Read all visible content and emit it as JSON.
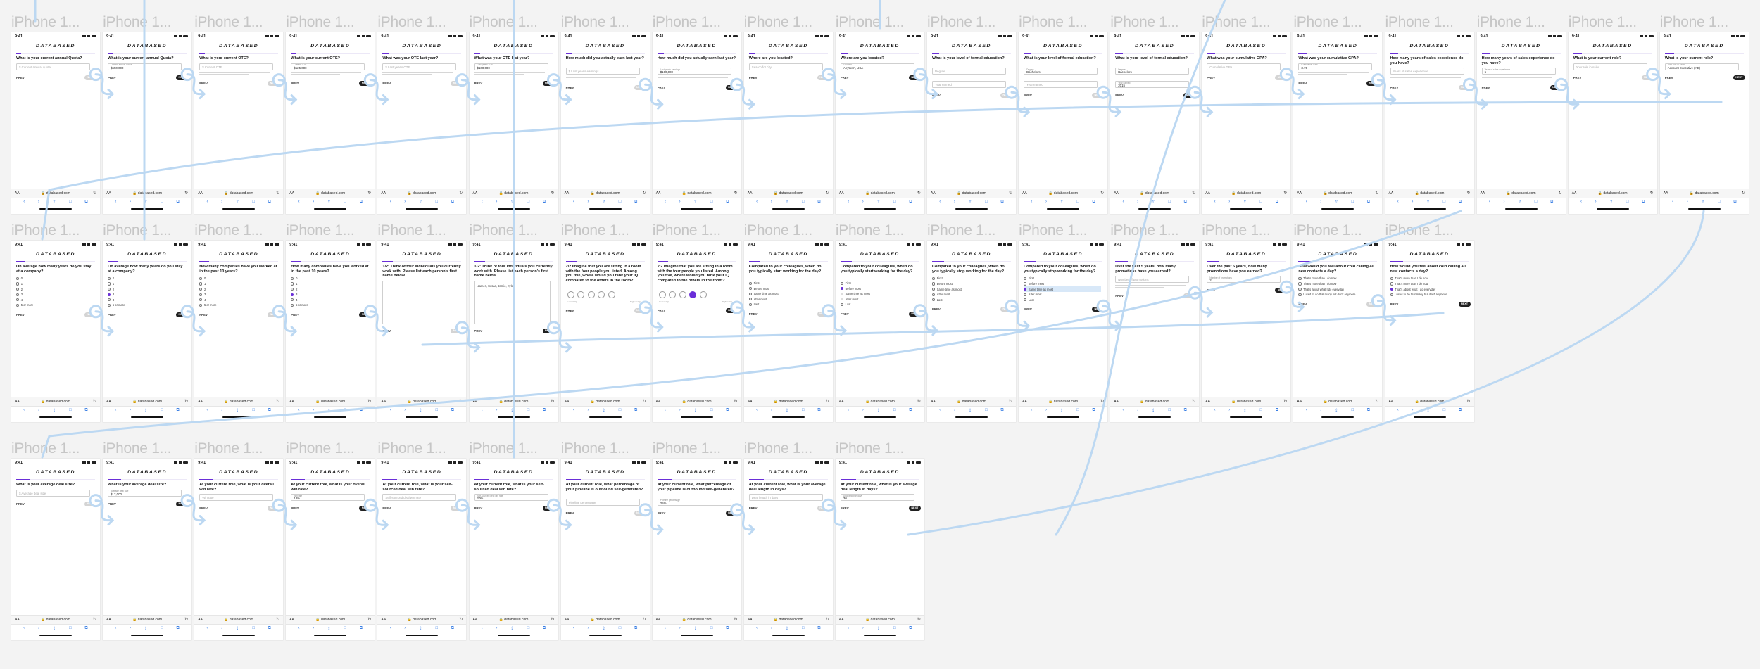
{
  "canvas": {
    "background": "#f3f3f3",
    "accent": "#6a2ed8",
    "flow_color": "#bcd8f2"
  },
  "frame_title": "iPhone 1...",
  "brand": "DATABASED",
  "status_time": "9:41",
  "url": "databased.com",
  "aa": "AA",
  "prev": "PREV",
  "next": "NEXT",
  "rows": [
    {
      "screens": [
        {
          "question": "What is your current annual Quota?",
          "field": {
            "placeholder": "$ Current annual quota"
          },
          "next_active": false
        },
        {
          "question": "What is your current annual Quota?",
          "field": {
            "label": "Current annual quota",
            "value": "$650,000"
          },
          "next_active": true
        },
        {
          "question": "What is your current OTE?",
          "field": {
            "placeholder": "$ Current OTE"
          },
          "hint": true,
          "next_active": false
        },
        {
          "question": "What is your current OTE?",
          "field": {
            "label": "Current OTE",
            "value": "$125,000"
          },
          "hint": true,
          "next_active": true
        },
        {
          "question": "What was your OTE last year?",
          "field": {
            "placeholder": "$ Last year's OTE"
          },
          "hint": true,
          "next_active": false
        },
        {
          "question": "What was your OTE last year?",
          "field": {
            "label": "Last year's OTE",
            "value": "$100,000"
          },
          "hint": true,
          "next_active": true
        },
        {
          "question": "How much did you actually earn last year?",
          "field": {
            "placeholder": "$ Last year's earnings"
          },
          "hint": true,
          "next_active": false
        },
        {
          "question": "How much did you actually earn last year?",
          "field": {
            "label": "Last year's earnings",
            "value": "$100,000"
          },
          "hint": true,
          "next_active": true
        },
        {
          "question": "Where are you located?",
          "field": {
            "placeholder": "Search for city"
          },
          "next_active": false
        },
        {
          "question": "Where are you located?",
          "field": {
            "label": "Location",
            "value": "Anytown, USA"
          },
          "next_active": true
        },
        {
          "question": "What is your level of formal education?",
          "field": {
            "placeholder": "Degree"
          },
          "field2": {
            "placeholder": "Year earned"
          },
          "next_active": false
        },
        {
          "question": "What is your level of formal education?",
          "field": {
            "label": "Degree",
            "value": "Bachelors"
          },
          "field2": {
            "placeholder": "Year earned"
          },
          "next_active": false
        },
        {
          "question": "What is your level of formal education?",
          "field": {
            "label": "Degree",
            "value": "Bachelors"
          },
          "field2": {
            "label": "Year earned",
            "value": "2015"
          },
          "next_active": true
        },
        {
          "question": "What was your cumulative GPA?",
          "field": {
            "placeholder": "Cumulative GPA"
          },
          "next_active": false
        },
        {
          "question": "What was your cumulative GPA?",
          "field": {
            "label": "Cumulative GPA",
            "value": "3.75"
          },
          "hint": true,
          "next_active": true
        },
        {
          "question": "How many years of sales experience do you have?",
          "field": {
            "placeholder": "Years of sales experience"
          },
          "hint": true,
          "next_active": false
        },
        {
          "question": "How many years of sales experience do you have?",
          "field": {
            "label": "Years of sales experience",
            "value": "5"
          },
          "hint": true,
          "next_active": true
        },
        {
          "question": "What is your current role?",
          "field": {
            "placeholder": "Your role in sales"
          },
          "next_active": false
        },
        {
          "question": "What is your current role?",
          "field": {
            "label": "Your role in sales",
            "value": "Account Executive (AE)"
          },
          "next_active": true
        }
      ]
    },
    {
      "screens": [
        {
          "question": "On average how many years do you stay at a company?",
          "options": [
            "0",
            "1",
            "2",
            "3",
            "4",
            "5 or more"
          ],
          "selected": -1,
          "next_active": false
        },
        {
          "question": "On average how many years do you stay at a company?",
          "options": [
            "0",
            "1",
            "2",
            "3",
            "4",
            "5 or more"
          ],
          "selected": 3,
          "next_active": true
        },
        {
          "question": "How many companies have you worked at in the past 10 years?",
          "options": [
            "0",
            "1",
            "2",
            "3",
            "4",
            "5 or more"
          ],
          "selected": -1,
          "next_active": false
        },
        {
          "question": "How many companies have you worked at in the past 10 years?",
          "options": [
            "0",
            "1",
            "2",
            "3",
            "4",
            "5 or more"
          ],
          "selected": 3,
          "next_active": true
        },
        {
          "question": "1/2: Think of four individuals you currently work with. Please list each person's first name below.",
          "textarea": "",
          "next_active": false
        },
        {
          "question": "1/2: Think of four individuals you currently work with. Please list each person's first name below.",
          "textarea": "James, Susan, Jamie, Kyle",
          "next_active": true
        },
        {
          "question": "2/2 Imagine that you are sitting in a room with the four people you listed. Among you five, where would you rank your IQ compared to the others in the room?",
          "circles": 5,
          "circle_selected": -1,
          "scale": [
            "Lowest IQ",
            "Highest IQ"
          ],
          "next_active": false
        },
        {
          "question": "2/2 Imagine that you are sitting in a room with the four people you listed. Among you five, where would you rank your IQ compared to the others in the room?",
          "circles": 5,
          "circle_selected": 3,
          "scale": [
            "Lowest IQ",
            "Highest IQ"
          ],
          "next_active": true
        },
        {
          "question": "Compared to your colleagues, when do you typically start working for the day?",
          "options": [
            "First",
            "Before most",
            "Same time as most",
            "After most",
            "Last"
          ],
          "selected": -1,
          "next_active": false
        },
        {
          "question": "Compared to your colleagues, when do you typically start working for the day?",
          "options": [
            "First",
            "Before most",
            "Same time as most",
            "After most",
            "Last"
          ],
          "selected": 1,
          "next_active": true
        },
        {
          "question": "Compared to your colleagues, when do you typically stop working for the day?",
          "options": [
            "First",
            "Before most",
            "Same time as most",
            "After most",
            "Last"
          ],
          "selected": -1,
          "next_active": false
        },
        {
          "question": "Compared to your colleagues, when do you typically stop working for the day?",
          "options": [
            "First",
            "Before most",
            "Same time as most",
            "After most",
            "Last"
          ],
          "selected": 2,
          "highlight": 2,
          "next_active": true
        },
        {
          "question": "Over the past 5 years, how many promotions have you earned?",
          "field": {
            "placeholder": "Number of promotions"
          },
          "hint": true,
          "next_active": false
        },
        {
          "question": "Over the past 5 years, how many promotions have you earned?",
          "field": {
            "label": "Number of promotions",
            "value": "2"
          },
          "next_active": true
        },
        {
          "question": "How would you feel about cold calling 40 new contacts a day?",
          "options": [
            "That's more than I do now",
            "That's more than I do now",
            "That's about what I do everyday",
            "I used to do that many but don't anymore"
          ],
          "selected": -1,
          "next_active": false
        },
        {
          "question": "How would you feel about cold calling 40 new contacts a day?",
          "options": [
            "That's more than I do now",
            "That's more than I do now",
            "That's about what I do everyday",
            "I used to do that many but don't anymore"
          ],
          "selected": 2,
          "next_active": true
        }
      ]
    },
    {
      "screens": [
        {
          "question": "What is your average deal size?",
          "field": {
            "placeholder": "$ Average deal size"
          },
          "next_active": false
        },
        {
          "question": "What is your average deal size?",
          "field": {
            "label": "Average deal size",
            "value": "$12,000"
          },
          "next_active": true
        },
        {
          "question": "At your current role, what is your overall win rate?",
          "field": {
            "placeholder": "Win rate"
          },
          "next_active": false
        },
        {
          "question": "At your current role, what is your overall win rate?",
          "field": {
            "label": "Win rate",
            "value": "18%"
          },
          "next_active": true
        },
        {
          "question": "At your current role, what is your self-sourced deal win rate?",
          "field": {
            "placeholder": "Self-sourced deal win rate"
          },
          "next_active": false
        },
        {
          "question": "At your current role, what is your self-sourced deal win rate?",
          "field": {
            "label": "Self-sourced deal win rate",
            "value": "20%"
          },
          "next_active": true
        },
        {
          "question": "At your current role, what percentage of your pipeline is outbound self-generated?",
          "field": {
            "placeholder": "Pipeline percentage"
          },
          "next_active": false
        },
        {
          "question": "At your current role, what percentage of your pipeline is outbound self-generated?",
          "field": {
            "label": "Pipeline percentage",
            "value": "25%"
          },
          "next_active": true
        },
        {
          "question": "At your current role, what is your average deal length in days?",
          "field": {
            "placeholder": "Deal length in days"
          },
          "next_active": false
        },
        {
          "question": "At your current role, what is your average deal length in days?",
          "field": {
            "label": "Deal length in days",
            "value": "30"
          },
          "next_active": true
        }
      ]
    }
  ]
}
